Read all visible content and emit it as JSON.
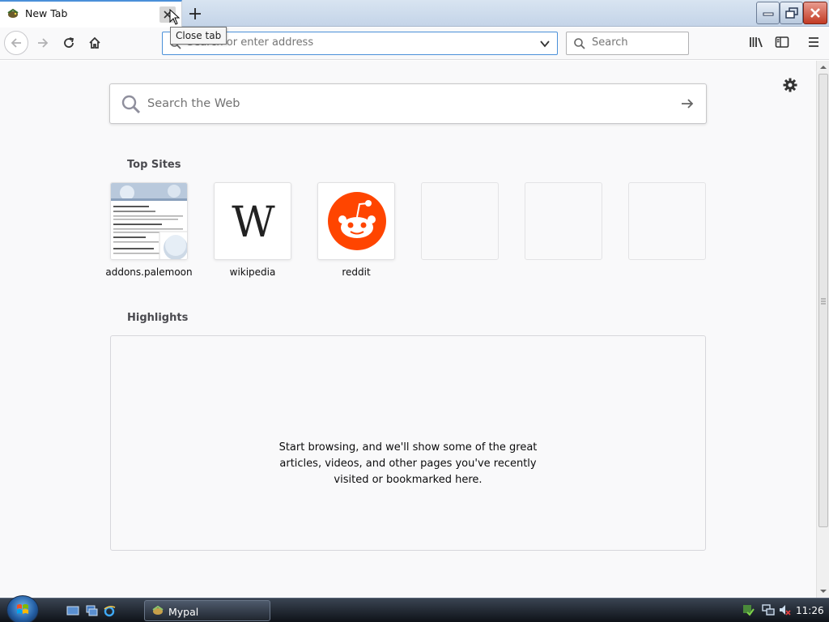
{
  "tab": {
    "title": "New Tab",
    "close_tooltip": "Close tab"
  },
  "navbar": {
    "url_placeholder": "Search or enter address",
    "search_placeholder": "Search"
  },
  "newtab": {
    "web_search_placeholder": "Search the Web",
    "top_sites_title": "Top Sites",
    "top_sites": [
      {
        "label": "addons.palemoon",
        "icon": "screenshot-thumbnail"
      },
      {
        "label": "wikipedia",
        "icon": "wikipedia-w"
      },
      {
        "label": "reddit",
        "icon": "reddit-alien"
      },
      {
        "label": "",
        "icon": "empty"
      },
      {
        "label": "",
        "icon": "empty"
      },
      {
        "label": "",
        "icon": "empty"
      }
    ],
    "highlights_title": "Highlights",
    "highlights_message": "Start browsing, and we'll show some of the great articles, videos, and other pages you've recently visited or bookmarked here."
  },
  "taskbar": {
    "task_label": "Mypal",
    "clock": "11:26"
  },
  "colors": {
    "reddit": "#ff4500",
    "accent": "#4a90d9"
  }
}
